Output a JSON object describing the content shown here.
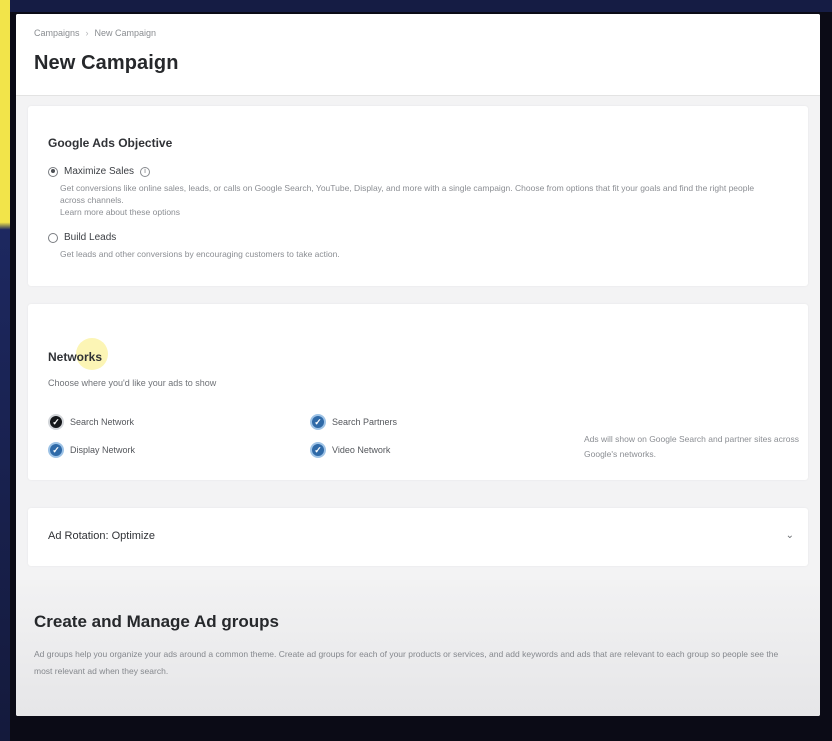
{
  "breadcrumb": {
    "items": [
      "Campaigns",
      "New Campaign"
    ],
    "separator": "›"
  },
  "page": {
    "title": "New Campaign"
  },
  "objective_card": {
    "title": "Google Ads Objective",
    "options": [
      {
        "label": "Maximize Sales",
        "selected": true,
        "description": "Get conversions like online sales, leads, or calls on Google Search, YouTube, Display, and more with a single campaign. Choose from options that fit your goals and find the right people across channels.",
        "description_line2": "Learn more about these options"
      },
      {
        "label": "Build Leads",
        "selected": false,
        "description": "Get leads and other conversions by encouraging customers to take action."
      }
    ]
  },
  "network_card": {
    "title": "Networks",
    "subtitle": "Choose where you'd like your ads to show",
    "options": [
      {
        "label": "Search Network",
        "checked": true,
        "style": "dark"
      },
      {
        "label": "Search Partners",
        "checked": true,
        "style": "blue"
      },
      {
        "label": "Display Network",
        "checked": true,
        "style": "blue"
      },
      {
        "label": "Video Network",
        "checked": true,
        "style": "blue"
      }
    ],
    "side_note": "Ads will show on Google Search and partner sites across Google's networks."
  },
  "adrotation_card": {
    "title": "Ad Rotation: Optimize",
    "chevron": "⌄"
  },
  "lower_section": {
    "title": "Create and Manage Ad groups",
    "description": "Ad groups help you organize your ads around a common theme. Create ad groups for each of your products or services, and add keywords and ads that are relevant to each group so people see the most relevant ad when they search."
  },
  "colors": {
    "accent_blue": "#2f6aa8",
    "highlight_yellow": "#f2e44a"
  }
}
